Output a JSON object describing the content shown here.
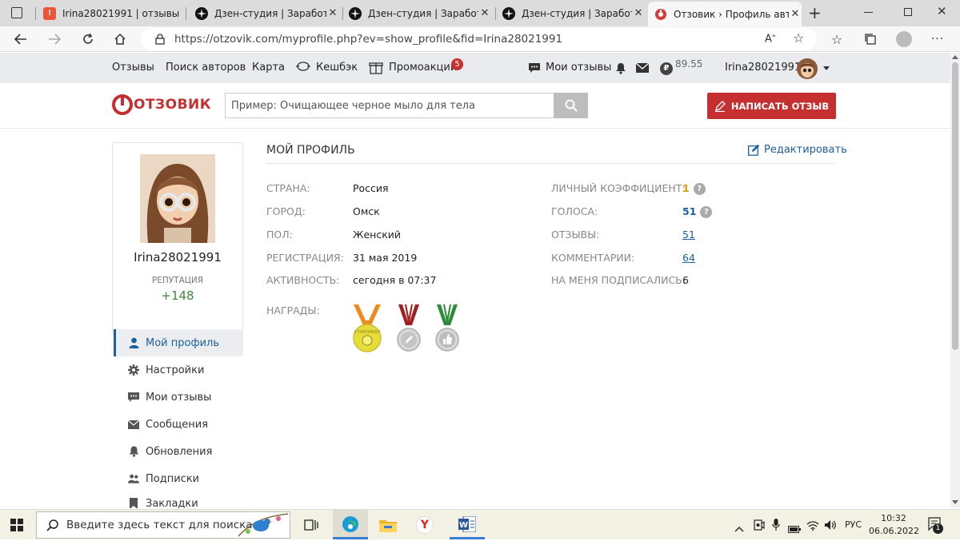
{
  "browser": {
    "tabs": [
      {
        "title": "Irina28021991 | отзывы",
        "icon": "otzovik-icon"
      },
      {
        "title": "Дзен-студия | Заработаем",
        "icon": "dzen-icon"
      },
      {
        "title": "Дзен-студия | Заработаем",
        "icon": "dzen-icon"
      },
      {
        "title": "Дзен-студия | Заработок",
        "icon": "dzen-icon"
      },
      {
        "title": "Отзовик › Профиль автора",
        "icon": "otzovik-icon",
        "active": true
      }
    ],
    "url": "https://otzovik.com/myprofile.php?ev=show_profile&fid=Irina28021991"
  },
  "sitenav": {
    "reviews": "Отзывы",
    "authors": "Поиск авторов",
    "map": "Карта",
    "cashback": "Кешбэк",
    "promo": "Промоакции",
    "promo_badge": "5",
    "my_reviews": "Мои отзывы",
    "balance": "89.55",
    "username": "Irina28021991"
  },
  "header": {
    "logo": "ОТЗОВИК",
    "search_placeholder": "Пример: Очищающее черное мыло для тела",
    "write_button": "НАПИСАТЬ ОТЗЫВ"
  },
  "sidebar": {
    "username": "Irina28021991",
    "reputation_label": "РЕПУТАЦИЯ",
    "reputation_value": "+148",
    "menu": [
      {
        "label": "Мой профиль",
        "icon": "user-icon",
        "active": true
      },
      {
        "label": "Настройки",
        "icon": "gear-icon"
      },
      {
        "label": "Мои отзывы",
        "icon": "chat-icon"
      },
      {
        "label": "Сообщения",
        "icon": "envelope-icon"
      },
      {
        "label": "Обновления",
        "icon": "bell-icon"
      },
      {
        "label": "Подписки",
        "icon": "users-icon"
      },
      {
        "label": "Закладки",
        "icon": "bookmark-icon"
      }
    ]
  },
  "profile": {
    "title": "МОЙ ПРОФИЛЬ",
    "edit": "Редактировать",
    "left": [
      {
        "label": "СТРАНА:",
        "value": "Россия"
      },
      {
        "label": "ГОРОД:",
        "value": "Омск"
      },
      {
        "label": "ПОЛ:",
        "value": "Женский"
      },
      {
        "label": "РЕГИСТРАЦИЯ:",
        "value": "31 мая 2019"
      },
      {
        "label": "АКТИВНОСТЬ:",
        "value": "сегодня в 07:37"
      }
    ],
    "right": [
      {
        "label": "ЛИЧНЫЙ КОЭФФИЦИЕНТ:",
        "value": "1"
      },
      {
        "label": "ГОЛОСА:",
        "value": "51"
      },
      {
        "label": "ОТЗЫВЫ:",
        "value": "51"
      },
      {
        "label": "КОММЕНТАРИИ:",
        "value": "64"
      },
      {
        "label": "НА МЕНЯ ПОДПИСАЛИСЬ:",
        "value": "6"
      }
    ],
    "awards_label": "НАГРАДЫ:",
    "award_ribbon_text": "СТАРОЖИЛ"
  },
  "taskbar": {
    "search_placeholder": "Введите здесь текст для поиска",
    "lang": "РУС",
    "time": "10:32",
    "date": "06.06.2022",
    "notif_count": "1"
  },
  "colors": {
    "accent_red": "#c62f2f",
    "link_blue": "#1a5f9e",
    "rep_green": "#3b8a3b",
    "coef_orange": "#d99a00"
  }
}
